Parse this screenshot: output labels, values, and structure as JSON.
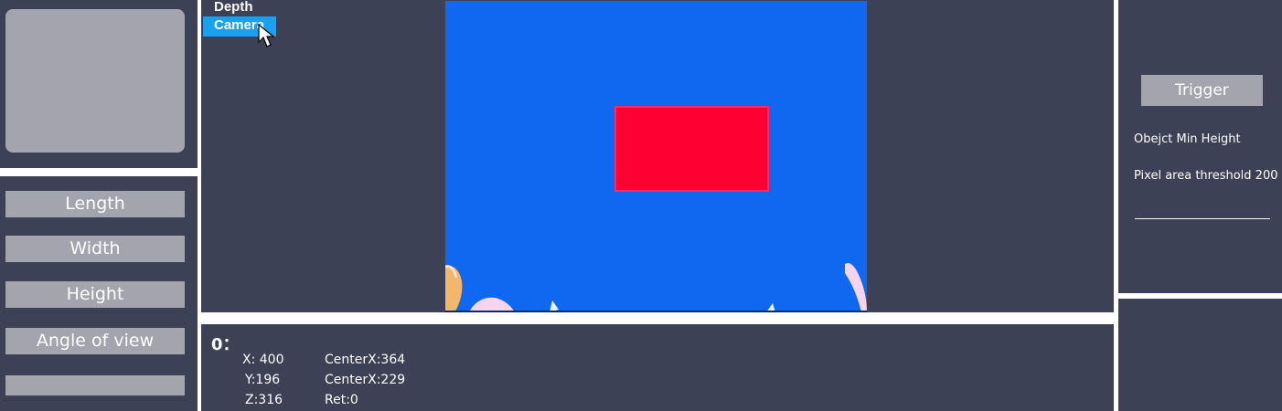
{
  "view_menu": {
    "items": [
      {
        "label": "Depth",
        "active": false
      },
      {
        "label": "Camera",
        "active": true
      }
    ]
  },
  "sidebar": {
    "buttons": [
      {
        "label": "Length"
      },
      {
        "label": "Width"
      },
      {
        "label": "Height"
      },
      {
        "label": "Angle of view"
      },
      {
        "label": ""
      }
    ]
  },
  "readout": {
    "title": "0：",
    "x": "X: 400",
    "y": "Y:196",
    "z": "Z:316",
    "center_x": "CenterX:364",
    "center_y": "CenterX:229",
    "ret": "Ret:0"
  },
  "right_panel": {
    "trigger_label": "Trigger",
    "object_min_height": "Obejct  Min Height",
    "pixel_area_threshold": "Pixel area threshold  200"
  },
  "colors": {
    "panel_bg": "#3d4156",
    "button_bg": "#a3a4ad",
    "camera_bg": "#1068f0",
    "detected_object": "#ff0033",
    "menu_active": "#1aa0ee"
  }
}
